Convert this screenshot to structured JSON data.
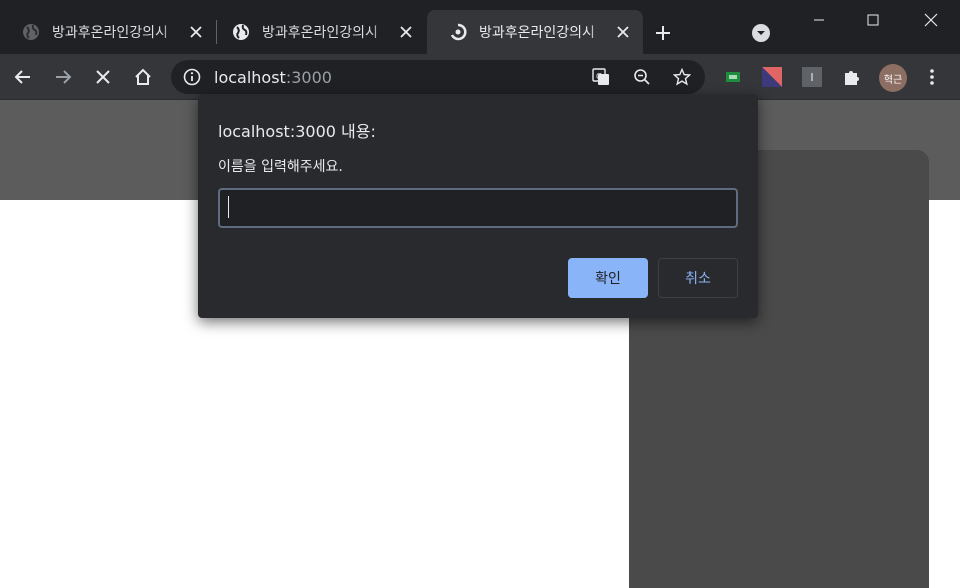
{
  "browser": {
    "tabs": [
      {
        "title": "방과후온라인강의시",
        "favicon": "globe-icon",
        "active": false
      },
      {
        "title": "방과후온라인강의시",
        "favicon": "globe-icon",
        "active": false
      },
      {
        "title": "방과후온라인강의시",
        "favicon": "loading-spinner-icon",
        "active": true
      }
    ],
    "address": {
      "host": "localhost",
      "port": ":3000"
    },
    "profile_initials": "혁근",
    "extension_label": "I"
  },
  "dialog": {
    "title": "localhost:3000 내용:",
    "message": "이름을 입력해주세요.",
    "input_value": "",
    "ok_label": "확인",
    "cancel_label": "취소"
  },
  "colors": {
    "accent": "#8ab4f8",
    "titlebar": "#202124",
    "toolbar": "#35363a",
    "dialog_bg": "#292a2d",
    "page_header": "#5c5c5c",
    "page_panel": "#4a4a4a"
  }
}
